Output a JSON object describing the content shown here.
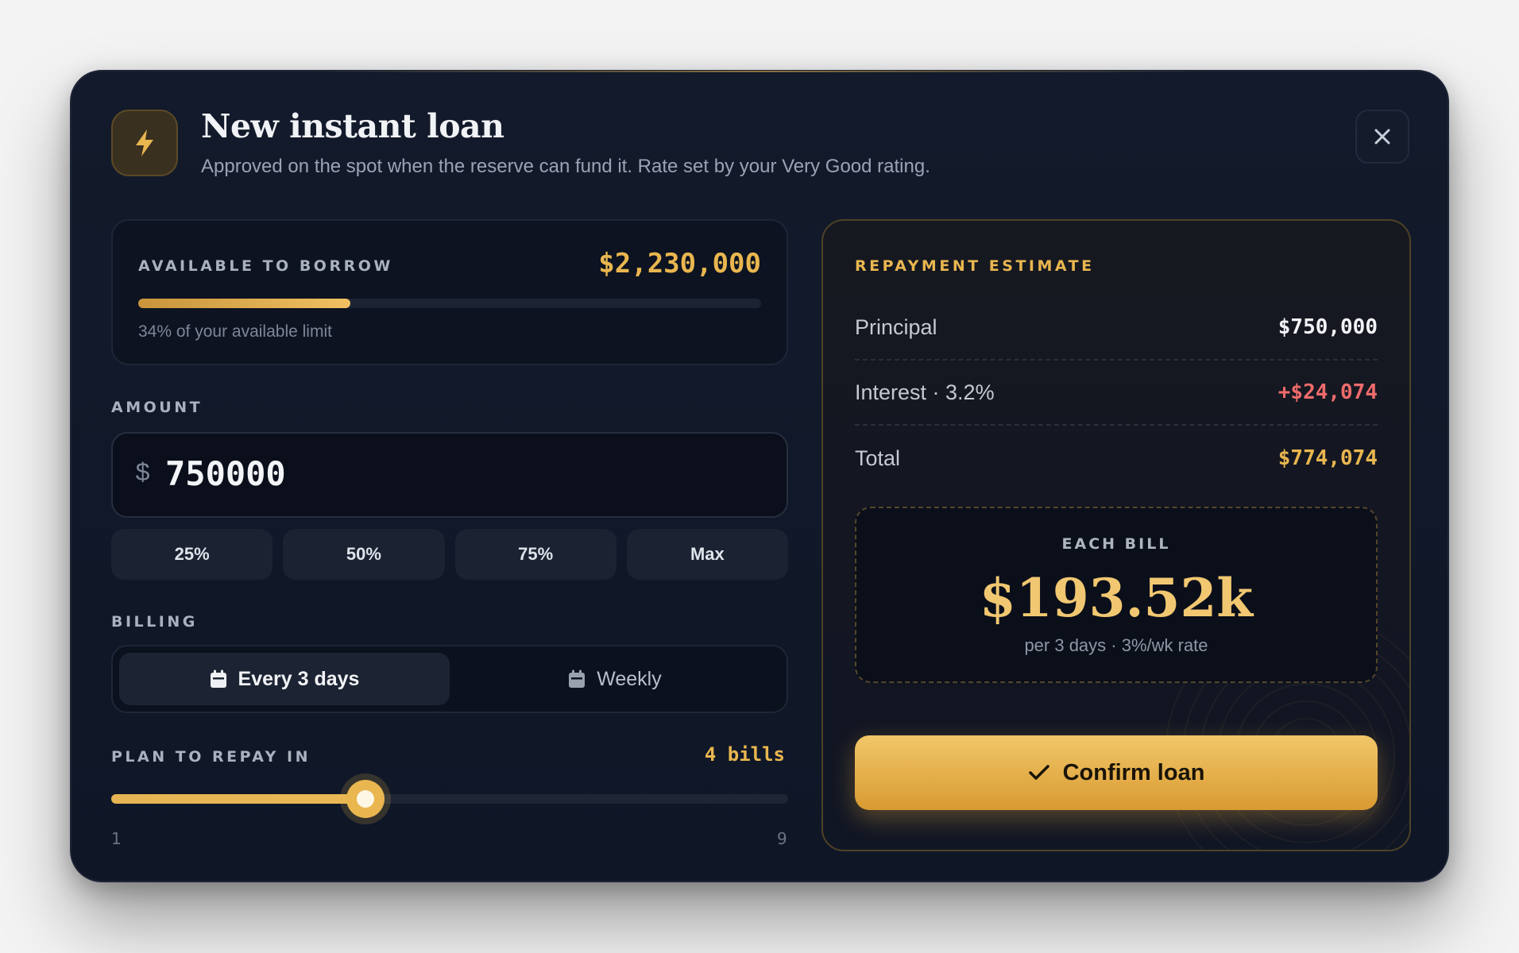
{
  "header": {
    "icon": "lightning-bolt-icon",
    "title": "New instant loan",
    "subtitle": "Approved on the spot when the reserve can fund it. Rate set by your Very Good rating.",
    "close_icon": "close-icon"
  },
  "available": {
    "label": "AVAILABLE TO BORROW",
    "value": "$2,230,000",
    "progress_fraction": 0.34,
    "note": "34% of your available limit"
  },
  "amount": {
    "label": "AMOUNT",
    "currency": "$",
    "value": "750000",
    "presets": [
      "25%",
      "50%",
      "75%",
      "Max"
    ]
  },
  "billing": {
    "label": "BILLING",
    "options": [
      {
        "label": "Every 3 days",
        "icon": "calendar-icon",
        "selected": true
      },
      {
        "label": "Weekly",
        "icon": "calendar-icon",
        "selected": false
      }
    ]
  },
  "plan": {
    "label": "PLAN TO REPAY IN",
    "value_text": "4 bills",
    "value": 4,
    "min": 1,
    "max": 9,
    "min_label": "1",
    "max_label": "9"
  },
  "estimate": {
    "label": "REPAYMENT ESTIMATE",
    "rows": [
      {
        "key": "Principal",
        "value": "$750,000",
        "color": "#f2f3f6"
      },
      {
        "key": "Interest · 3.2%",
        "value": "+$24,074",
        "color": "#ef6b6b"
      },
      {
        "key": "Total",
        "value": "$774,074",
        "color": "#e9b64f"
      }
    ],
    "each_bill": {
      "label": "EACH BILL",
      "value": "$193.52k",
      "note": "per 3 days · 3%/wk rate"
    },
    "confirm_label": "Confirm loan",
    "confirm_icon": "checkmark-icon"
  },
  "colors": {
    "accent": "#e9b64f",
    "background": "#121a2b",
    "negative": "#ef6b6b"
  }
}
